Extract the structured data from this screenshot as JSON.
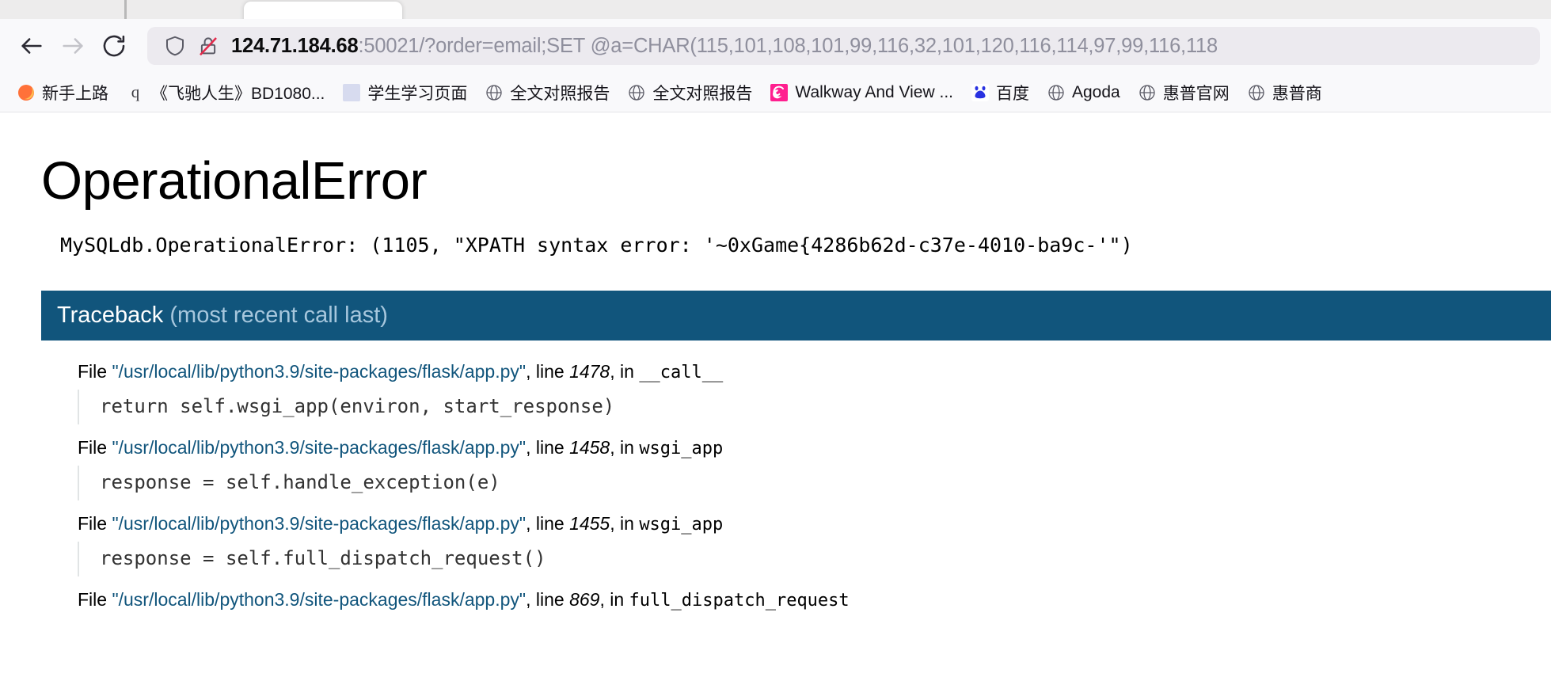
{
  "browser": {
    "nav": {
      "back_label": "Back",
      "forward_label": "Forward",
      "reload_label": "Reload"
    },
    "address_bar": {
      "shield_icon": "shield-icon",
      "lock_icon": "lock-crossed-insecure-icon",
      "host": "124.71.184.68",
      "rest": ":50021/?order=email;SET @a=CHAR(115,101,108,101,99,116,32,101,120,116,114,97,99,116,118"
    },
    "bookmarks": [
      {
        "label": "新手上路",
        "icon": "firefox-icon"
      },
      {
        "label": "《飞驰人生》BD1080...",
        "icon": "letter-q-icon"
      },
      {
        "label": "学生学习页面",
        "icon": "blank-square-icon"
      },
      {
        "label": "全文对照报告",
        "icon": "globe-icon"
      },
      {
        "label": "全文对照报告",
        "icon": "globe-icon"
      },
      {
        "label": "Walkway And View ...",
        "icon": "spiral-pink-icon"
      },
      {
        "label": "百度",
        "icon": "baidu-icon"
      },
      {
        "label": "Agoda",
        "icon": "globe-icon"
      },
      {
        "label": "惠普官网",
        "icon": "globe-icon"
      },
      {
        "label": "惠普商",
        "icon": "globe-icon"
      }
    ]
  },
  "page": {
    "title": "OperationalError",
    "message": "MySQLdb.OperationalError: (1105, \"XPATH syntax error: '~0xGame{4286b62d-c37e-4010-ba9c-'\")",
    "traceback": {
      "heading": "Traceback",
      "heading_suffix": "(most recent call last)",
      "frames": [
        {
          "file_prefix": "File ",
          "path": "\"/usr/local/lib/python3.9/site-packages/flask/app.py\"",
          "line_label": ", line ",
          "line_number": "1478",
          "in_label": ", in ",
          "function": "__call__",
          "source": "return self.wsgi_app(environ, start_response)"
        },
        {
          "file_prefix": "File ",
          "path": "\"/usr/local/lib/python3.9/site-packages/flask/app.py\"",
          "line_label": ", line ",
          "line_number": "1458",
          "in_label": ", in ",
          "function": "wsgi_app",
          "source": "response = self.handle_exception(e)"
        },
        {
          "file_prefix": "File ",
          "path": "\"/usr/local/lib/python3.9/site-packages/flask/app.py\"",
          "line_label": ", line ",
          "line_number": "1455",
          "in_label": ", in ",
          "function": "wsgi_app",
          "source": "response = self.full_dispatch_request()"
        },
        {
          "file_prefix": "File ",
          "path": "\"/usr/local/lib/python3.9/site-packages/flask/app.py\"",
          "line_label": ", line ",
          "line_number": "869",
          "in_label": ", in ",
          "function": "full_dispatch_request",
          "source": ""
        }
      ]
    }
  },
  "colors": {
    "traceback_header_bg": "#11557c",
    "link_blue": "#11557c",
    "chrome_bg": "#f9f9fb",
    "urlbar_bg": "#eceaef"
  }
}
